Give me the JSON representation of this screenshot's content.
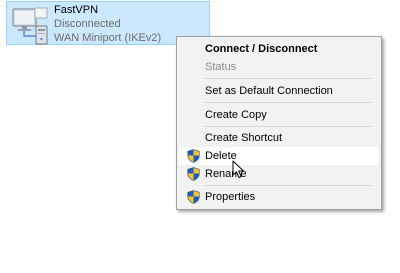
{
  "connection": {
    "name": "FastVPN",
    "status": "Disconnected",
    "device": "WAN Miniport (IKEv2)",
    "icon": "network-adapter-icon"
  },
  "context_menu": {
    "items": [
      {
        "label": "Connect / Disconnect",
        "style": "bold"
      },
      {
        "label": "Status",
        "style": "disabled"
      },
      {
        "label": "Set as Default Connection"
      },
      {
        "label": "Create Copy"
      },
      {
        "label": "Create Shortcut"
      },
      {
        "label": "Delete",
        "icon": "uac-shield-icon",
        "state": "hovered"
      },
      {
        "label": "Rename",
        "icon": "uac-shield-icon"
      },
      {
        "label": "Properties",
        "icon": "uac-shield-icon"
      }
    ]
  },
  "colors": {
    "selection_fill": "#cce8ff",
    "selection_border": "#99d1ff",
    "menu_background": "#f2f2f2",
    "hover_background": "#ffffff",
    "disabled_text": "#8a8a8a"
  }
}
